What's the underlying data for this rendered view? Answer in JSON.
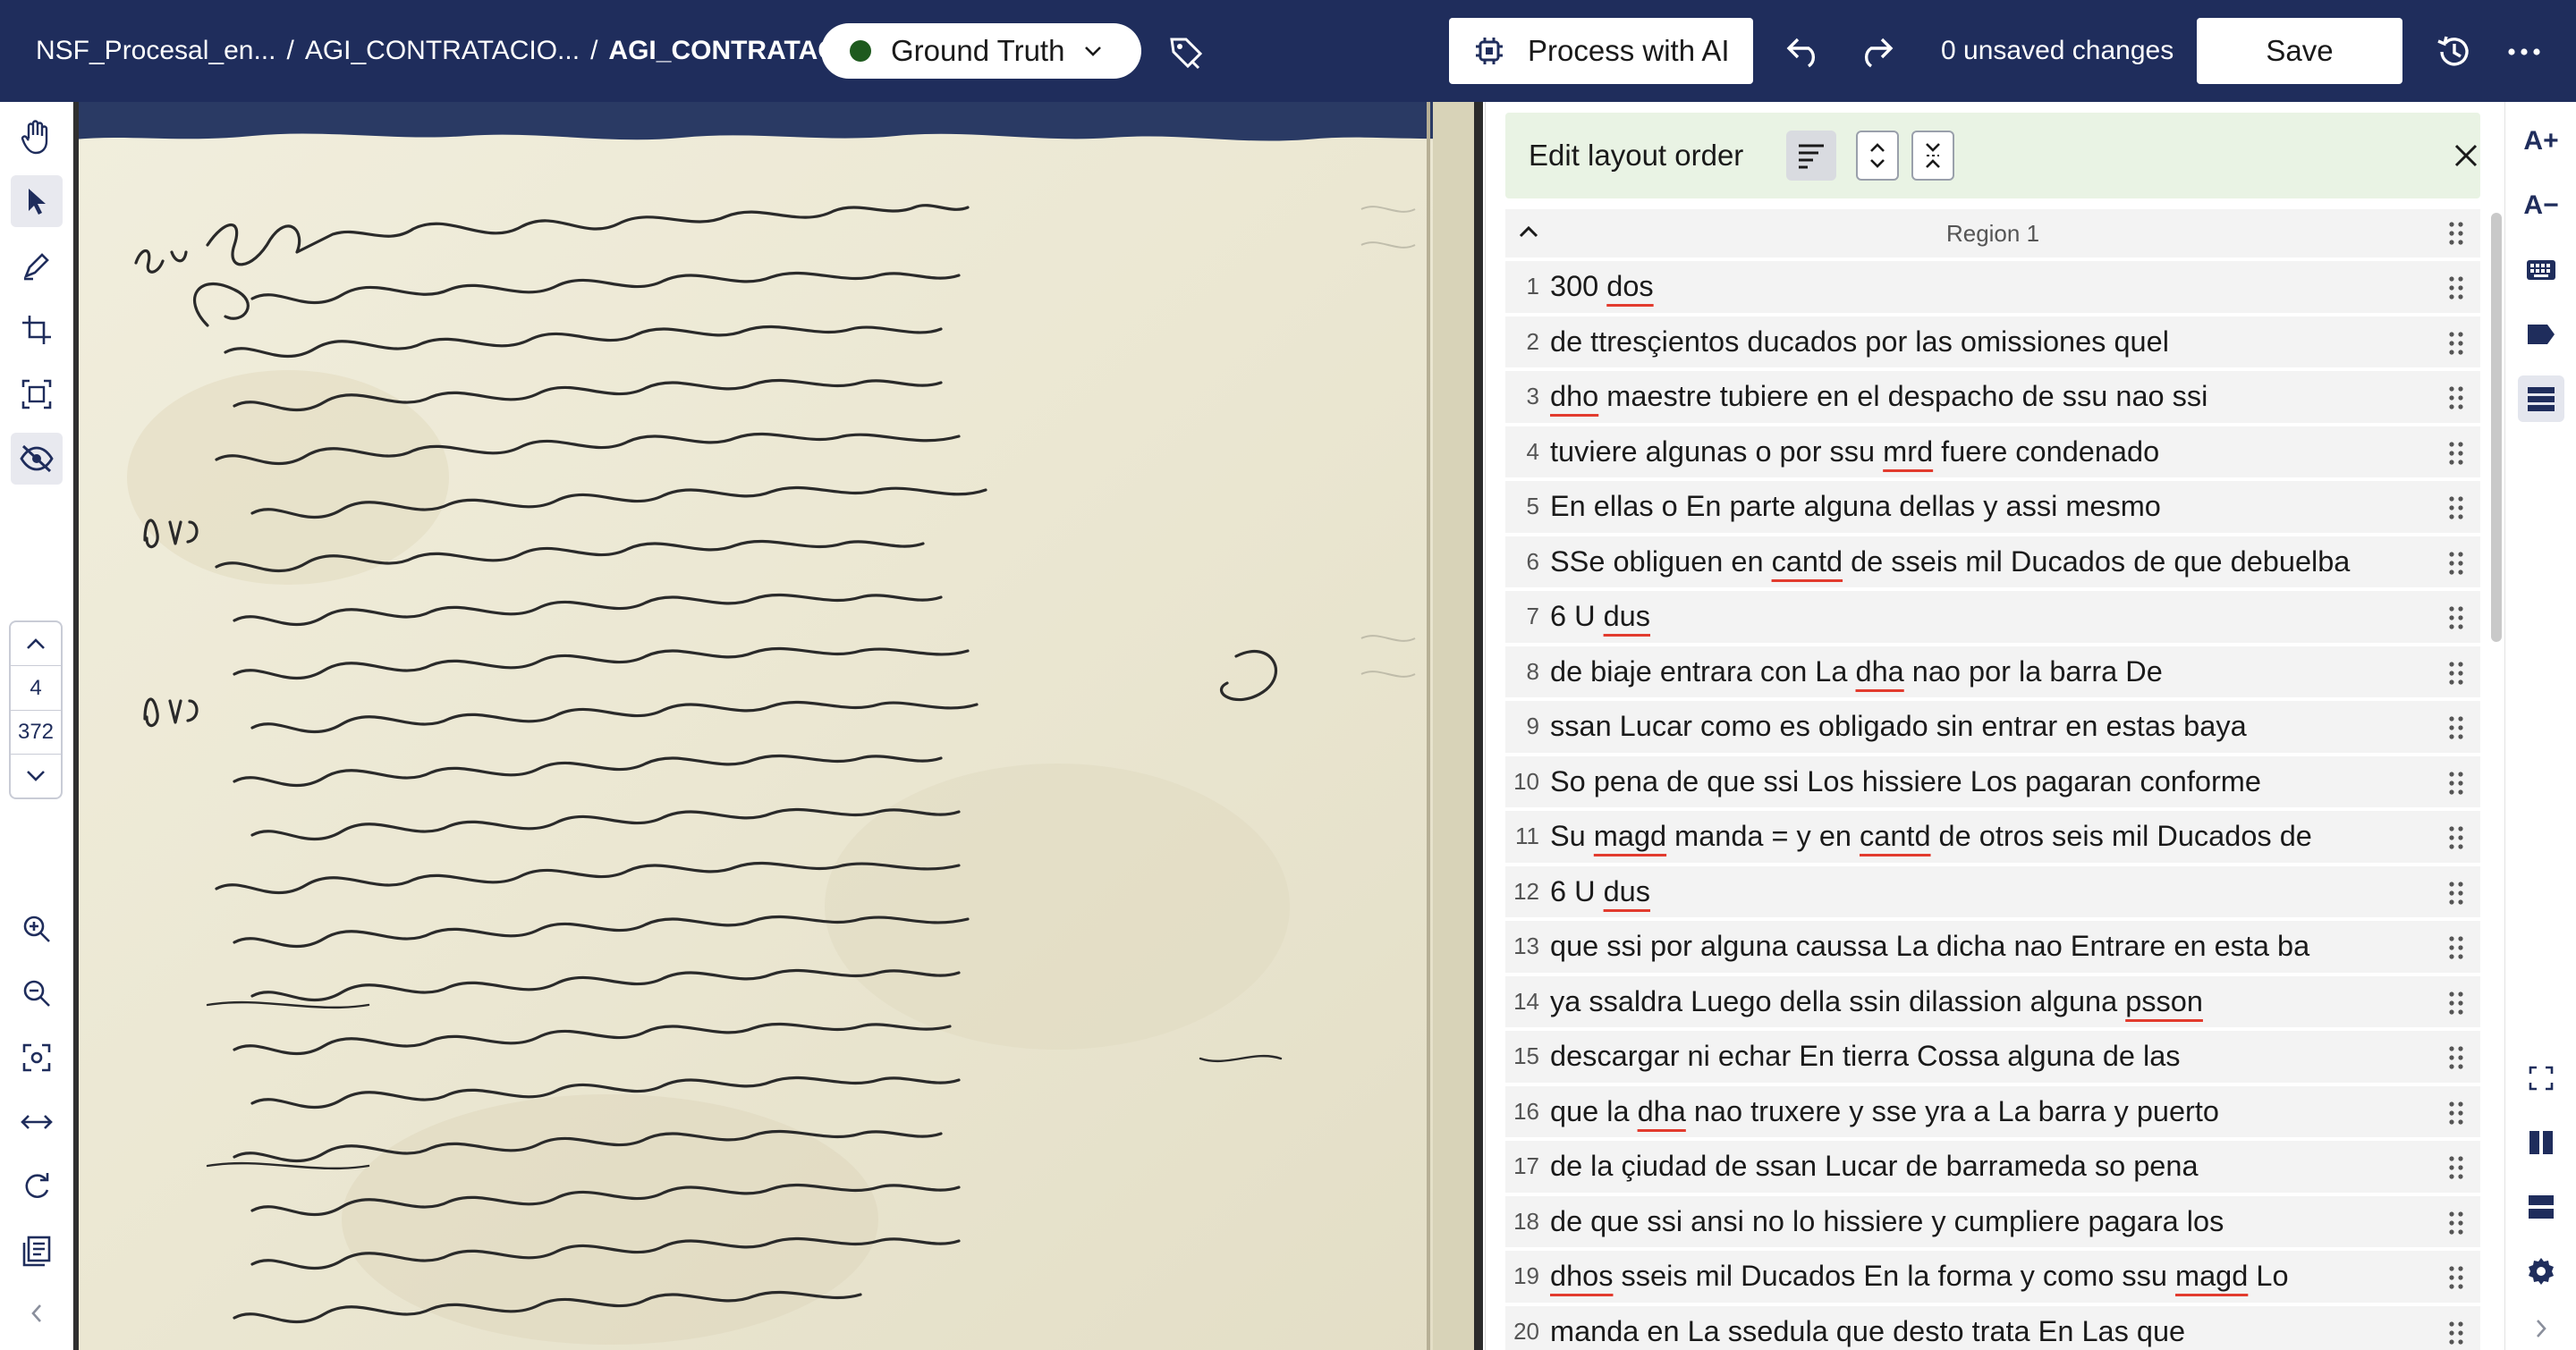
{
  "header": {
    "breadcrumb": [
      "NSF_Procesal_en...",
      "AGI_CONTRATACIO...",
      "AGI_CONTRATACIO..."
    ],
    "breadcrumb_sep": "/",
    "status_pill": "Ground Truth",
    "process_ai_label": "Process with AI",
    "unsaved_label": "0 unsaved changes",
    "save_label": "Save",
    "colors": {
      "bar": "#1f2d5c",
      "status_dot": "#1e5a1e"
    }
  },
  "pager": {
    "current": "4",
    "total": "372"
  },
  "panel": {
    "edit_title": "Edit layout order",
    "region_label": "Region 1",
    "lines": [
      {
        "n": "1",
        "parts": [
          [
            "300 ",
            false
          ],
          [
            "dos",
            true
          ]
        ]
      },
      {
        "n": "2",
        "parts": [
          [
            "de ttresçientos ducados por las omissiones quel",
            false
          ]
        ]
      },
      {
        "n": "3",
        "parts": [
          [
            "dho",
            true
          ],
          [
            " maestre tubiere en el despacho de ssu nao ssi",
            false
          ]
        ]
      },
      {
        "n": "4",
        "parts": [
          [
            "tuviere algunas o por ssu ",
            false
          ],
          [
            "mrd",
            true
          ],
          [
            " fuere condenado",
            false
          ]
        ]
      },
      {
        "n": "5",
        "parts": [
          [
            "En ellas o En parte alguna dellas y assi mesmo",
            false
          ]
        ]
      },
      {
        "n": "6",
        "parts": [
          [
            "SSe obliguen en ",
            false
          ],
          [
            "cantd",
            true
          ],
          [
            " de sseis mil Ducados de que debuelba",
            false
          ]
        ]
      },
      {
        "n": "7",
        "parts": [
          [
            "6 U ",
            false
          ],
          [
            "dus",
            true
          ]
        ]
      },
      {
        "n": "8",
        "parts": [
          [
            "de biaje entrara con La ",
            false
          ],
          [
            "dha",
            true
          ],
          [
            " nao por la barra De",
            false
          ]
        ]
      },
      {
        "n": "9",
        "parts": [
          [
            "ssan Lucar como es obligado sin entrar en estas baya",
            false
          ]
        ]
      },
      {
        "n": "10",
        "parts": [
          [
            "So pena de que ssi Los hissiere Los pagaran conforme",
            false
          ]
        ]
      },
      {
        "n": "11",
        "parts": [
          [
            "Su ",
            false
          ],
          [
            "magd",
            true
          ],
          [
            " manda = y en ",
            false
          ],
          [
            "cantd",
            true
          ],
          [
            " de otros seis mil Ducados de",
            false
          ]
        ]
      },
      {
        "n": "12",
        "parts": [
          [
            "6 U ",
            false
          ],
          [
            "dus",
            true
          ]
        ]
      },
      {
        "n": "13",
        "parts": [
          [
            "que ssi por alguna caussa La dicha nao Entrare en esta ba",
            false
          ]
        ]
      },
      {
        "n": "14",
        "parts": [
          [
            "ya ssaldra Luego della ssin dilassion alguna ",
            false
          ],
          [
            "psson",
            true
          ]
        ]
      },
      {
        "n": "15",
        "parts": [
          [
            "descargar ni echar En tierra Cossa alguna de las",
            false
          ]
        ]
      },
      {
        "n": "16",
        "parts": [
          [
            "que la ",
            false
          ],
          [
            "dha",
            true
          ],
          [
            " nao truxere y sse yra a La barra y puerto",
            false
          ]
        ]
      },
      {
        "n": "17",
        "parts": [
          [
            "de la çiudad de ssan Lucar de barrameda so pena",
            false
          ]
        ]
      },
      {
        "n": "18",
        "parts": [
          [
            "de que ssi ansi no lo hissiere y cumpliere pagara los",
            false
          ]
        ]
      },
      {
        "n": "19",
        "parts": [
          [
            "dhos",
            true
          ],
          [
            " sseis mil Ducados En la forma y como ssu ",
            false
          ],
          [
            "magd",
            true
          ],
          [
            " Lo",
            false
          ]
        ]
      },
      {
        "n": "20",
        "parts": [
          [
            "manda en La ssedula que desto trata En Las que",
            false
          ]
        ]
      }
    ]
  },
  "icons": {
    "left_rail": [
      "hand-icon",
      "pointer-icon",
      "pen-icon",
      "crop-icon",
      "select-region-icon",
      "visibility-off-icon",
      "zoom-in-icon",
      "zoom-out-icon",
      "fit-screen-icon",
      "fit-width-icon",
      "rotate-icon",
      "book-icon",
      "chevron-left-icon"
    ],
    "right_rail": [
      "font-increase-icon",
      "font-decrease-icon",
      "keyboard-icon",
      "label-icon",
      "layout-order-icon",
      "fullscreen-icon",
      "two-column-icon",
      "split-view-icon",
      "settings-icon",
      "chevron-right-icon"
    ]
  },
  "right_rail_labels": {
    "font_up": "A+",
    "font_down": "A−"
  }
}
